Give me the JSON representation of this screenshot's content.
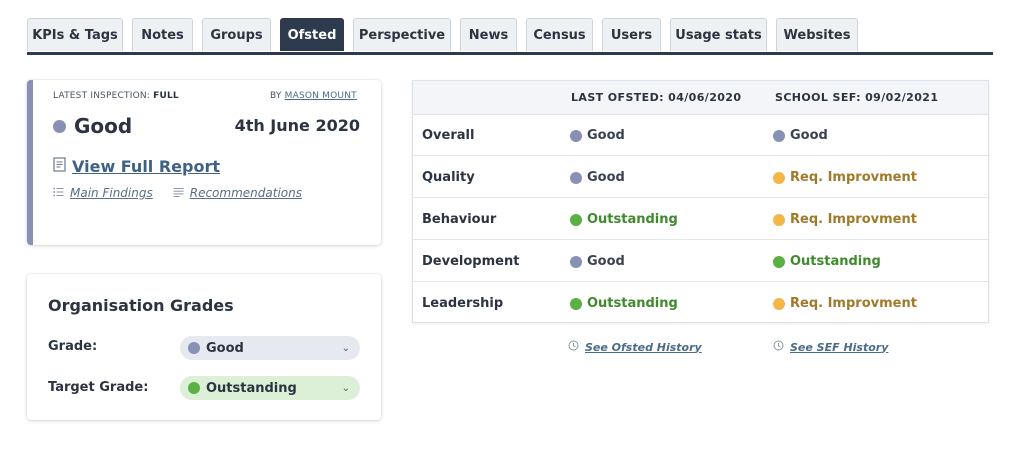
{
  "tabs": [
    "KPIs & Tags",
    "Notes",
    "Groups",
    "Ofsted",
    "Perspective",
    "News",
    "Census",
    "Users",
    "Usage stats",
    "Websites"
  ],
  "active_tab": "Ofsted",
  "inspection": {
    "latest_label": "LATEST INSPECTION:",
    "type": "FULL",
    "by_label": "BY",
    "inspector": "MASON MOUNT",
    "grade": "Good",
    "date": "4th June 2020",
    "report_link": "View Full Report",
    "main_findings": "Main Findings",
    "recommendations": "Recommendations"
  },
  "org": {
    "title": "Organisation Grades",
    "grade_label": "Grade:",
    "grade_value": "Good",
    "target_label": "Target Grade:",
    "target_value": "Outstanding"
  },
  "table": {
    "col_a": "LAST OFSTED: 04/06/2020",
    "col_b": "SCHOOL SEF: 09/02/2021",
    "rows": [
      {
        "label": "Overall",
        "a": "Good",
        "a_status": "grey",
        "b": "Good",
        "b_status": "grey"
      },
      {
        "label": "Quality",
        "a": "Good",
        "a_status": "grey",
        "b": "Req. Improvment",
        "b_status": "amber"
      },
      {
        "label": "Behaviour",
        "a": "Outstanding",
        "a_status": "green",
        "b": "Req. Improvment",
        "b_status": "amber"
      },
      {
        "label": "Development",
        "a": "Good",
        "a_status": "grey",
        "b": "Outstanding",
        "b_status": "green"
      },
      {
        "label": "Leadership",
        "a": "Outstanding",
        "a_status": "green",
        "b": "Req. Improvment",
        "b_status": "amber"
      }
    ]
  },
  "history": {
    "ofsted": "See Ofsted History",
    "sef": "See SEF History"
  },
  "colors": {
    "tab_active": "#2e3b4e",
    "good": "#8890b5",
    "outstanding": "#5bb044",
    "requires_improvement": "#f4b646"
  },
  "icons": [
    "report-icon",
    "list-icon",
    "text-lines-icon",
    "history-icon",
    "chevron-down-icon"
  ]
}
